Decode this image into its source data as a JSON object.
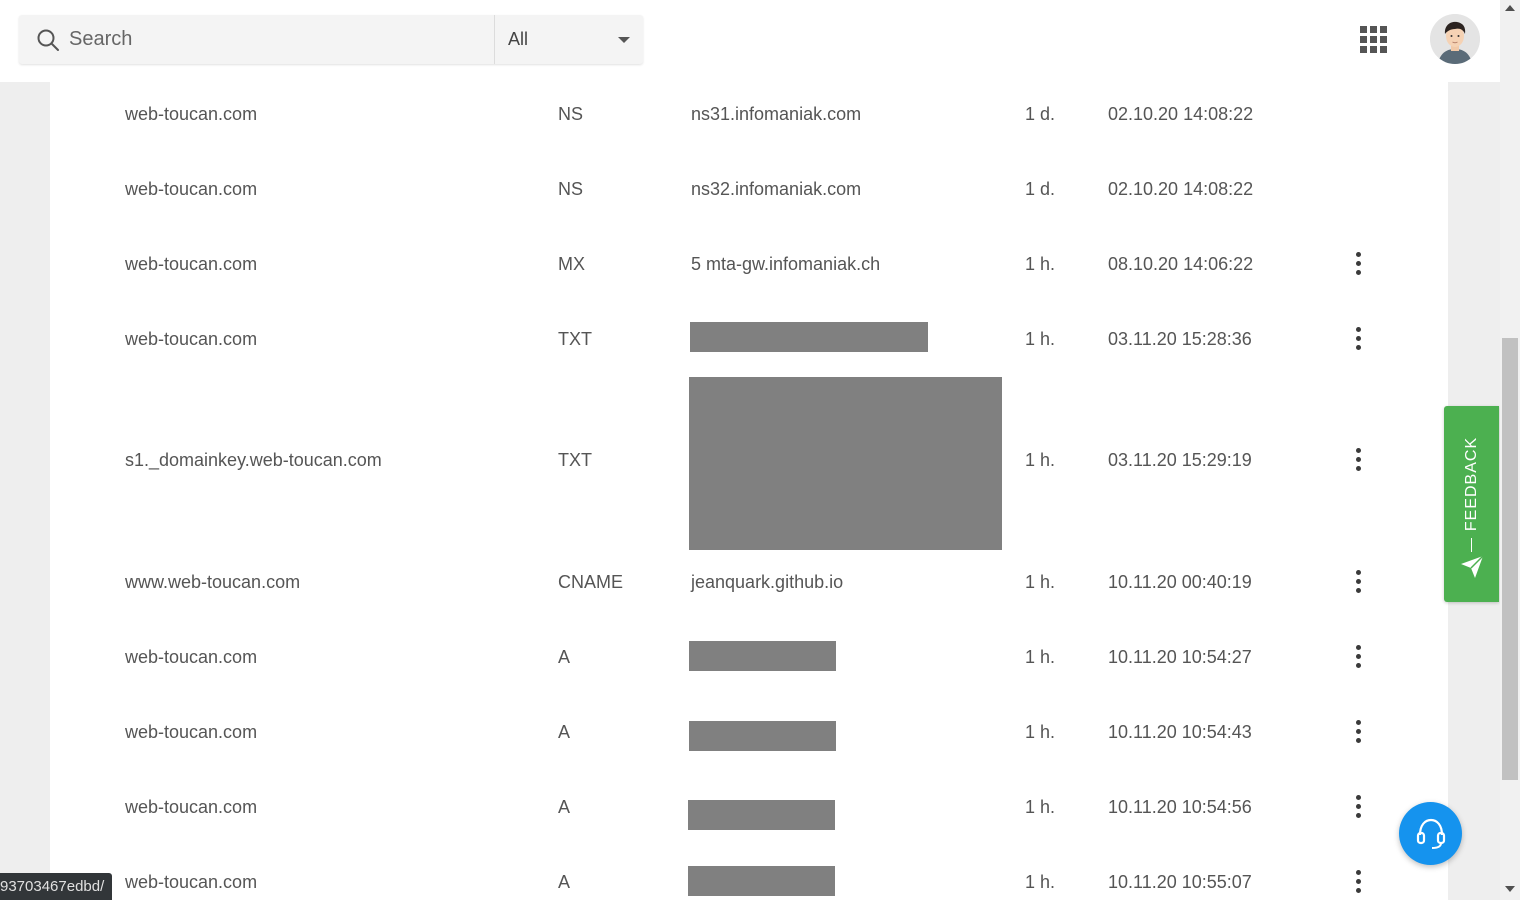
{
  "search": {
    "placeholder": "Search",
    "filter_value": "All"
  },
  "icons": {
    "search": "search-icon",
    "apps": "apps-grid-icon",
    "row_menu": "more-vertical-icon",
    "feedback": "paper-plane-icon",
    "support": "headset-icon"
  },
  "records": [
    {
      "name": "web-toucan.com",
      "type": "NS",
      "target": "ns31.infomaniak.com",
      "ttl": "1 d.",
      "date": "02.10.20 14:08:22",
      "has_menu": false,
      "redacted": false
    },
    {
      "name": "web-toucan.com",
      "type": "NS",
      "target": "ns32.infomaniak.com",
      "ttl": "1 d.",
      "date": "02.10.20 14:08:22",
      "has_menu": false,
      "redacted": false
    },
    {
      "name": "web-toucan.com",
      "type": "MX",
      "target": "5 mta-gw.infomaniak.ch",
      "ttl": "1 h.",
      "date": "08.10.20 14:06:22",
      "has_menu": true,
      "redacted": false
    },
    {
      "name": "web-toucan.com",
      "type": "TXT",
      "target": "",
      "ttl": "1 h.",
      "date": "03.11.20 15:28:36",
      "has_menu": true,
      "redacted": true
    },
    {
      "name": "s1._domainkey.web-toucan.com",
      "type": "TXT",
      "target": "",
      "ttl": "1 h.",
      "date": "03.11.20 15:29:19",
      "has_menu": true,
      "redacted": true
    },
    {
      "name": "www.web-toucan.com",
      "type": "CNAME",
      "target": "jeanquark.github.io",
      "ttl": "1 h.",
      "date": "10.11.20 00:40:19",
      "has_menu": true,
      "redacted": false
    },
    {
      "name": "web-toucan.com",
      "type": "A",
      "target": "",
      "ttl": "1 h.",
      "date": "10.11.20 10:54:27",
      "has_menu": true,
      "redacted": true
    },
    {
      "name": "web-toucan.com",
      "type": "A",
      "target": "",
      "ttl": "1 h.",
      "date": "10.11.20 10:54:43",
      "has_menu": true,
      "redacted": true
    },
    {
      "name": "web-toucan.com",
      "type": "A",
      "target": "",
      "ttl": "1 h.",
      "date": "10.11.20 10:54:56",
      "has_menu": true,
      "redacted": true
    },
    {
      "name": "web-toucan.com",
      "type": "A",
      "target": "",
      "ttl": "1 h.",
      "date": "10.11.20 10:55:07",
      "has_menu": true,
      "redacted": true
    }
  ],
  "feedback": {
    "label": "FEEDBACK",
    "color": "#4cb050"
  },
  "support": {
    "color": "#1593ee"
  },
  "status_bar": {
    "url": "93703467edbd/"
  }
}
